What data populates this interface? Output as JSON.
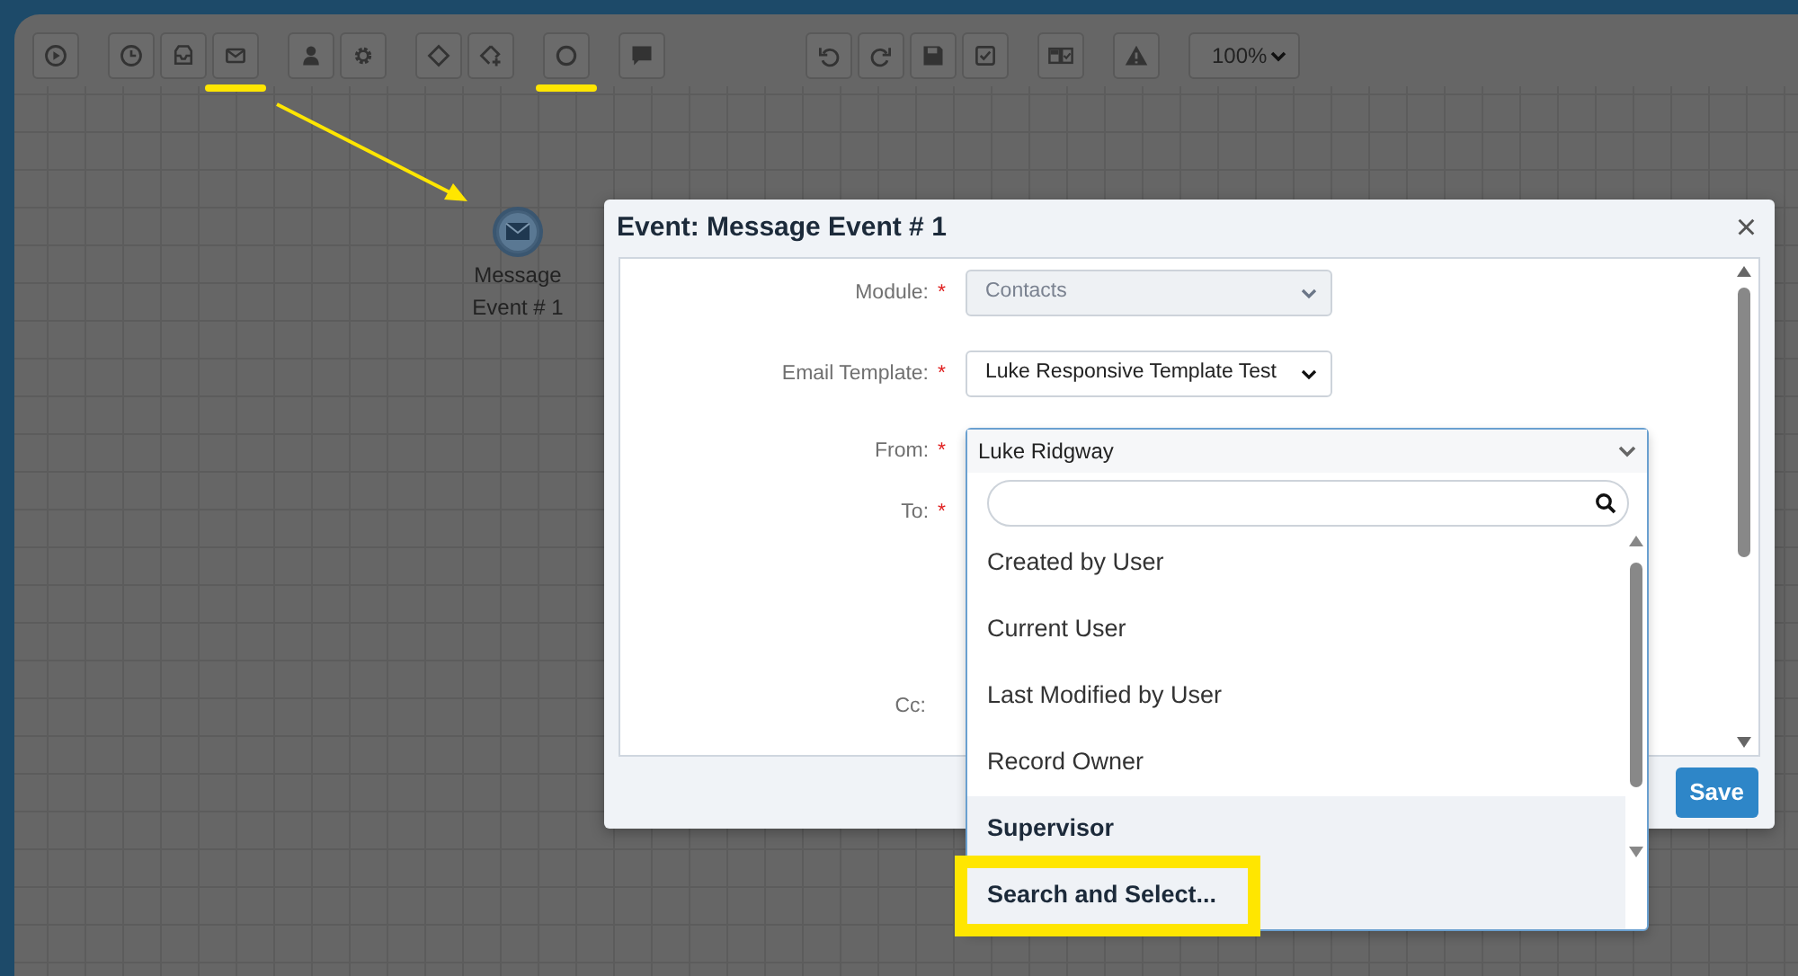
{
  "toolbar": {
    "groups": [
      [
        {
          "kind": "play",
          "highlighted": false
        }
      ],
      [
        {
          "kind": "clock",
          "highlighted": false
        },
        {
          "kind": "inbox",
          "highlighted": false
        },
        {
          "kind": "envelope",
          "highlighted": true
        }
      ],
      [
        {
          "kind": "person",
          "highlighted": false
        },
        {
          "kind": "gear",
          "highlighted": false
        }
      ],
      [
        {
          "kind": "diamond",
          "highlighted": false
        },
        {
          "kind": "diamond-plus",
          "highlighted": false
        }
      ],
      [
        {
          "kind": "circle",
          "highlighted": true
        }
      ],
      [
        {
          "kind": "comment",
          "highlighted": false
        }
      ],
      [
        {
          "kind": "undo",
          "highlighted": false
        },
        {
          "kind": "redo",
          "highlighted": false
        },
        {
          "kind": "save",
          "highlighted": false
        },
        {
          "kind": "check",
          "highlighted": false
        }
      ],
      [
        {
          "kind": "cards",
          "highlighted": false
        }
      ],
      [
        {
          "kind": "warning",
          "highlighted": false
        }
      ]
    ],
    "zoom": {
      "value": "100%"
    }
  },
  "canvas": {
    "nodes": [
      {
        "kind": "message-event",
        "label": "Message Event # 1"
      }
    ]
  },
  "modal": {
    "title": "Event: Message Event # 1",
    "close": "×",
    "fields": [
      {
        "label": "Module:",
        "required_mark": "*",
        "kind": "select",
        "value": "Contacts",
        "disabled": true
      },
      {
        "label": "Email Template:",
        "required_mark": "*",
        "kind": "select",
        "value": "Luke Responsive Template Test",
        "disabled": false
      },
      {
        "label": "From:",
        "required_mark": "*",
        "kind": "combo",
        "value": "Luke Ridgway",
        "disabled": false
      },
      {
        "label": "To:",
        "required_mark": "*",
        "kind": "hidden"
      },
      {
        "label": "Cc:",
        "kind": "hidden"
      }
    ],
    "dropdown": {
      "options": [
        {
          "label": "Created by User",
          "selected": false
        },
        {
          "label": "Current User",
          "selected": false
        },
        {
          "label": "Last Modified by User",
          "selected": false
        },
        {
          "label": "Record Owner",
          "selected": false
        },
        {
          "label": "Supervisor",
          "selected": true
        }
      ],
      "action": {
        "label": "Search and Select...",
        "highlighted": true
      }
    },
    "buttons": [
      {
        "label": "Save"
      }
    ]
  }
}
